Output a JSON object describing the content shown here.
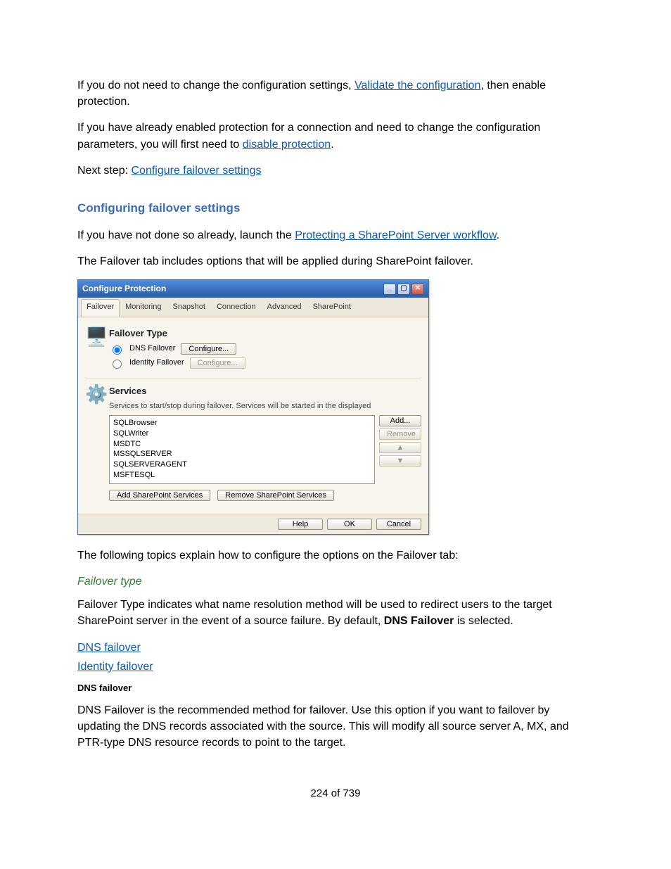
{
  "para1_a": "If you do not need to change the configuration settings, ",
  "link_validate": "Validate the configuration",
  "para1_b": ", then enable protection.",
  "para2_a": "If you have already enabled protection for a connection and need to change the configuration parameters, you will first need to ",
  "link_disable_protection": "disable protection",
  "para2_b": ".",
  "nextstep_label": "Next step: ",
  "link_configure_failover": "Configure failover settings",
  "heading_cfg_failover": "Configuring failover settings",
  "para3_a": "If you have not done so already, launch the ",
  "link_workflow": "Protecting a SharePoint Server workflow",
  "para3_b": ".",
  "para4": "The Failover tab includes options that will be applied during SharePoint failover.",
  "dialog": {
    "title": "Configure Protection",
    "tabs": [
      "Failover",
      "Monitoring",
      "Snapshot",
      "Connection",
      "Advanced",
      "SharePoint"
    ],
    "failover": {
      "section_title": "Failover Type",
      "dns_label": "DNS Failover",
      "identity_label": "Identity Failover",
      "configure_btn": "Configure...",
      "configure_btn2": "Configure..."
    },
    "services": {
      "section_title": "Services",
      "subtitle": "Services to start/stop during failover.  Services will be started in the displayed",
      "items": [
        "SQLBrowser",
        "SQLWriter",
        "MSDTC",
        "MSSQLSERVER",
        "SQLSERVERAGENT",
        "MSFTESQL"
      ],
      "add_btn": "Add...",
      "remove_btn": "Remove",
      "up_icon": "▲",
      "down_icon": "▼",
      "add_sp_btn": "Add SharePoint Services",
      "remove_sp_btn": "Remove SharePoint Services"
    },
    "footer": {
      "help": "Help",
      "ok": "OK",
      "cancel": "Cancel"
    }
  },
  "para5": "The following topics explain how to configure the options on the Failover tab:",
  "heading_failover_type": "Failover type",
  "para6_a": "Failover Type indicates what name resolution method will be used to redirect users to the target SharePoint server in the event of a source failure. By default, ",
  "para6_bold": "DNS Failover",
  "para6_b": " is selected.",
  "link_dns_failover": "DNS failover",
  "link_identity_failover": "Identity failover",
  "heading_dns_failover": "DNS failover",
  "para7": "DNS Failover is the recommended method for failover. Use this option if you want to failover by updating the DNS records associated with the source. This will modify all source server A, MX, and PTR-type DNS resource records to point to the target.",
  "page_number": "224 of 739"
}
